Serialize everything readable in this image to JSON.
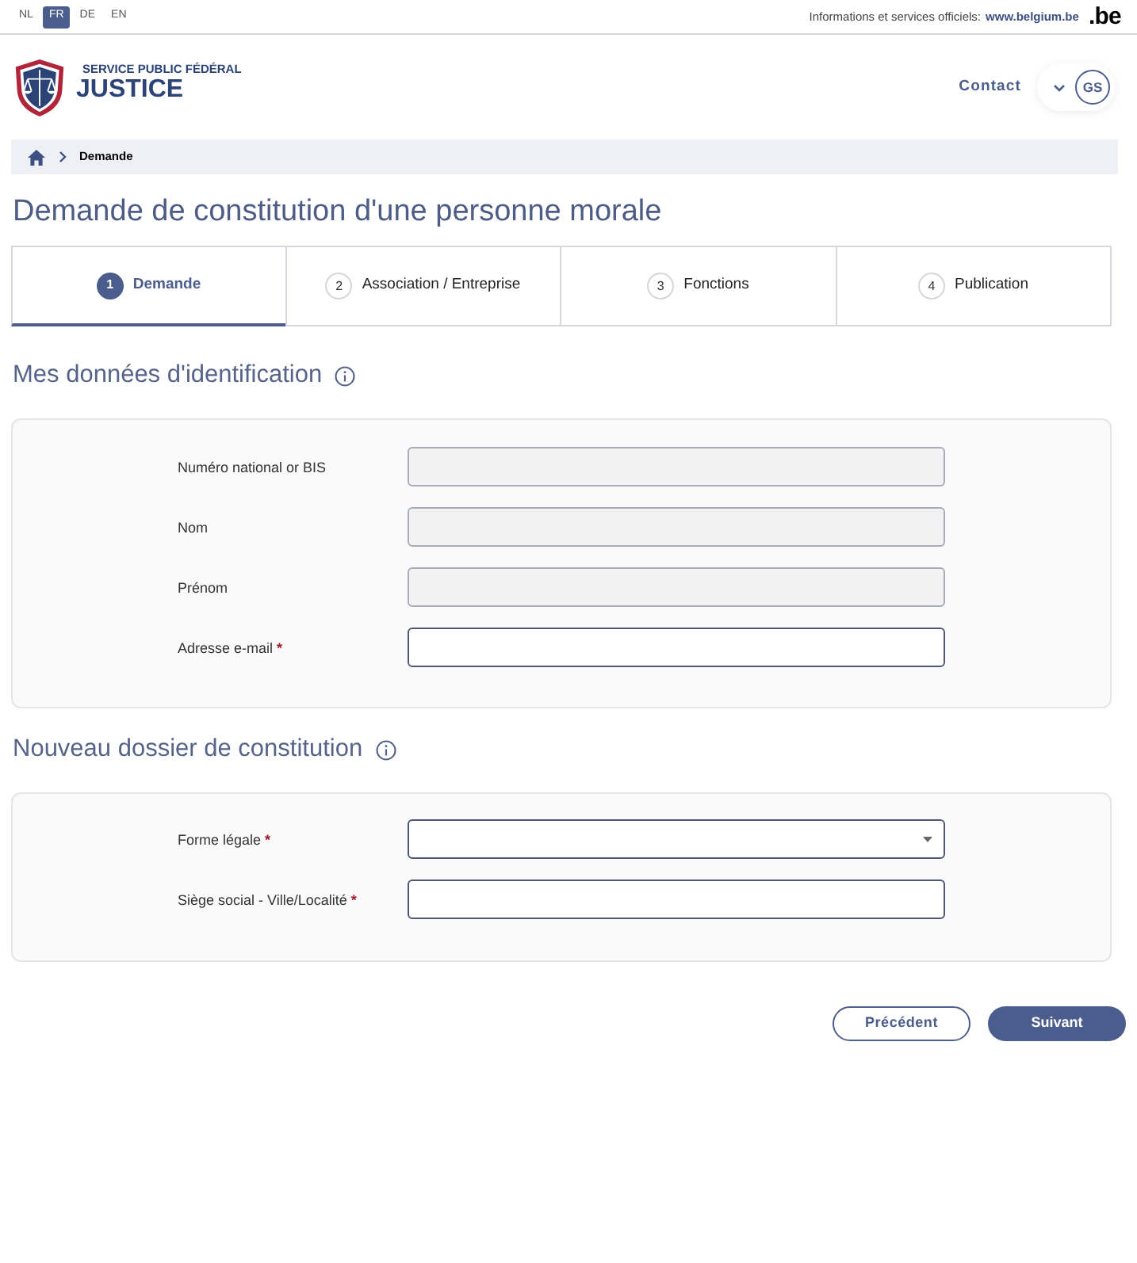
{
  "language_bar": {
    "languages": [
      {
        "label": "NL",
        "selected": false
      },
      {
        "label": "FR",
        "selected": true
      },
      {
        "label": "DE",
        "selected": false
      },
      {
        "label": "EN",
        "selected": false
      }
    ],
    "official_info": {
      "text": "Informations et services officiels:",
      "link": "www.belgium.be",
      "logo": ".be"
    }
  },
  "header": {
    "logo": {
      "line_1": "SERVICE PUBLIC FÉDÉRAL",
      "line_2": "JUSTICE"
    },
    "contact_link": "Contact",
    "user_initials": "GS"
  },
  "breadcrumb": {
    "items": [
      "Demande"
    ]
  },
  "page_title": "Demande de constitution d'une personne morale",
  "steps": [
    {
      "number": "1",
      "label": "Demande",
      "selected": true
    },
    {
      "number": "2",
      "label": "Association / Entreprise",
      "selected": false
    },
    {
      "number": "3",
      "label": "Fonctions",
      "selected": false
    },
    {
      "number": "4",
      "label": "Publication",
      "selected": false
    }
  ],
  "sections": [
    {
      "title": "Mes données d'identification",
      "fields": [
        {
          "label": "Numéro national or BIS",
          "kind": "text",
          "disabled": true
        },
        {
          "label": "Nom",
          "kind": "text",
          "disabled": true
        },
        {
          "label": "Prénom",
          "kind": "text",
          "disabled": true
        },
        {
          "label": "Adresse e-mail",
          "required_mark": "*",
          "kind": "text",
          "disabled": false
        }
      ]
    },
    {
      "title": "Nouveau dossier de constitution",
      "fields": [
        {
          "label": "Forme légale",
          "required_mark": "*",
          "kind": "select",
          "disabled": false
        },
        {
          "label": "Siège social - Ville/Localité",
          "required_mark": "*",
          "kind": "text",
          "disabled": false
        }
      ]
    }
  ],
  "buttons": [
    {
      "label": "Précédent",
      "kind": "secondary"
    },
    {
      "label": "Suivant",
      "kind": "primary"
    }
  ]
}
